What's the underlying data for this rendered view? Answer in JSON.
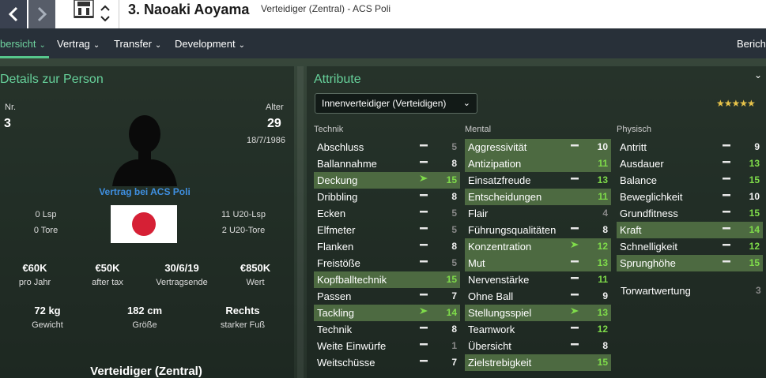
{
  "header": {
    "player_name": "3. Naoaki Aoyama",
    "subtitle": "Verteidiger (Zentral) - ACS Poli"
  },
  "menu": {
    "items": [
      {
        "label": "bersicht"
      },
      {
        "label": "Vertrag"
      },
      {
        "label": "Transfer"
      },
      {
        "label": "Development"
      }
    ],
    "right_label": "Bericht"
  },
  "details": {
    "title": "Details zur Person",
    "number_label": "Nr.",
    "number": "3",
    "age_label": "Alter",
    "age": "29",
    "birthdate": "18/7/1986",
    "contract": "Vertrag bei ACS Poli",
    "nation_caps": "0 Lsp",
    "nation_goals": "0 Tore",
    "u20_caps": "11 U20-Lsp",
    "u20_goals": "2 U20-Tore",
    "wage": "€60K",
    "wage_label": "pro Jahr",
    "after_tax": "€50K",
    "after_tax_label": "after tax",
    "contract_end": "30/6/19",
    "contract_end_label": "Vertragsende",
    "value": "€850K",
    "value_label": "Wert",
    "weight": "72 kg",
    "weight_label": "Gewicht",
    "height": "182 cm",
    "height_label": "Größe",
    "foot": "Rechts",
    "foot_label": "starker Fuß",
    "position": "Verteidiger (Zentral)",
    "flag_color": "#d62035"
  },
  "attributes": {
    "title": "Attribute",
    "role_select": "Innenverteidiger (Verteidigen)",
    "stars": "★★★★★",
    "rating_stars": 4.5,
    "technik_head": "Technik",
    "mental_head": "Mental",
    "physisch_head": "Physisch",
    "technik": [
      {
        "name": "Abschluss",
        "value": "5",
        "trend": "flat",
        "hl": false
      },
      {
        "name": "Ballannahme",
        "value": "8",
        "trend": "flat",
        "hl": false
      },
      {
        "name": "Deckung",
        "value": "15",
        "trend": "up",
        "hl": true
      },
      {
        "name": "Dribbling",
        "value": "8",
        "trend": "flat",
        "hl": false
      },
      {
        "name": "Ecken",
        "value": "5",
        "trend": "flat",
        "hl": false
      },
      {
        "name": "Elfmeter",
        "value": "5",
        "trend": "flat",
        "hl": false
      },
      {
        "name": "Flanken",
        "value": "8",
        "trend": "flat",
        "hl": false
      },
      {
        "name": "Freistöße",
        "value": "5",
        "trend": "flat",
        "hl": false
      },
      {
        "name": "Kopfballtechnik",
        "value": "15",
        "trend": "none",
        "hl": true
      },
      {
        "name": "Passen",
        "value": "7",
        "trend": "flat",
        "hl": false
      },
      {
        "name": "Tackling",
        "value": "14",
        "trend": "up",
        "hl": true
      },
      {
        "name": "Technik",
        "value": "8",
        "trend": "flat",
        "hl": false
      },
      {
        "name": "Weite Einwürfe",
        "value": "1",
        "trend": "flat",
        "hl": false
      },
      {
        "name": "Weitschüsse",
        "value": "7",
        "trend": "flat",
        "hl": false
      }
    ],
    "mental": [
      {
        "name": "Aggressivität",
        "value": "10",
        "trend": "flat",
        "hl": true
      },
      {
        "name": "Antizipation",
        "value": "11",
        "trend": "none",
        "hl": true
      },
      {
        "name": "Einsatzfreude",
        "value": "13",
        "trend": "flat",
        "hl": false
      },
      {
        "name": "Entscheidungen",
        "value": "11",
        "trend": "none",
        "hl": true
      },
      {
        "name": "Flair",
        "value": "4",
        "trend": "none",
        "hl": false
      },
      {
        "name": "Führungsqualitäten",
        "value": "8",
        "trend": "flat",
        "hl": false
      },
      {
        "name": "Konzentration",
        "value": "12",
        "trend": "up",
        "hl": true
      },
      {
        "name": "Mut",
        "value": "13",
        "trend": "flat",
        "hl": true
      },
      {
        "name": "Nervenstärke",
        "value": "11",
        "trend": "flat",
        "hl": false
      },
      {
        "name": "Ohne Ball",
        "value": "9",
        "trend": "flat",
        "hl": false
      },
      {
        "name": "Stellungsspiel",
        "value": "13",
        "trend": "up",
        "hl": true
      },
      {
        "name": "Teamwork",
        "value": "12",
        "trend": "flat",
        "hl": false
      },
      {
        "name": "Übersicht",
        "value": "8",
        "trend": "flat",
        "hl": false
      },
      {
        "name": "Zielstrebigkeit",
        "value": "15",
        "trend": "none",
        "hl": true
      }
    ],
    "physisch": [
      {
        "name": "Antritt",
        "value": "9",
        "trend": "flat",
        "hl": false
      },
      {
        "name": "Ausdauer",
        "value": "13",
        "trend": "flat",
        "hl": false
      },
      {
        "name": "Balance",
        "value": "15",
        "trend": "flat",
        "hl": false
      },
      {
        "name": "Beweglichkeit",
        "value": "10",
        "trend": "flat",
        "hl": false
      },
      {
        "name": "Grundfitness",
        "value": "15",
        "trend": "flat",
        "hl": false
      },
      {
        "name": "Kraft",
        "value": "14",
        "trend": "flat",
        "hl": true
      },
      {
        "name": "Schnelligkeit",
        "value": "12",
        "trend": "flat",
        "hl": false
      },
      {
        "name": "Sprunghöhe",
        "value": "15",
        "trend": "flat",
        "hl": true
      }
    ],
    "goalkeeper_label": "Torwartwertung",
    "goalkeeper_value": "3"
  },
  "colors": {
    "accent": "#56c78c",
    "highlight_row": "#4d6a41",
    "value_green": "#7fdc4a",
    "value_white": "#f2f2f2",
    "value_gray": "#888888",
    "link_blue": "#3f8fe0",
    "star": "#e7c34a"
  }
}
